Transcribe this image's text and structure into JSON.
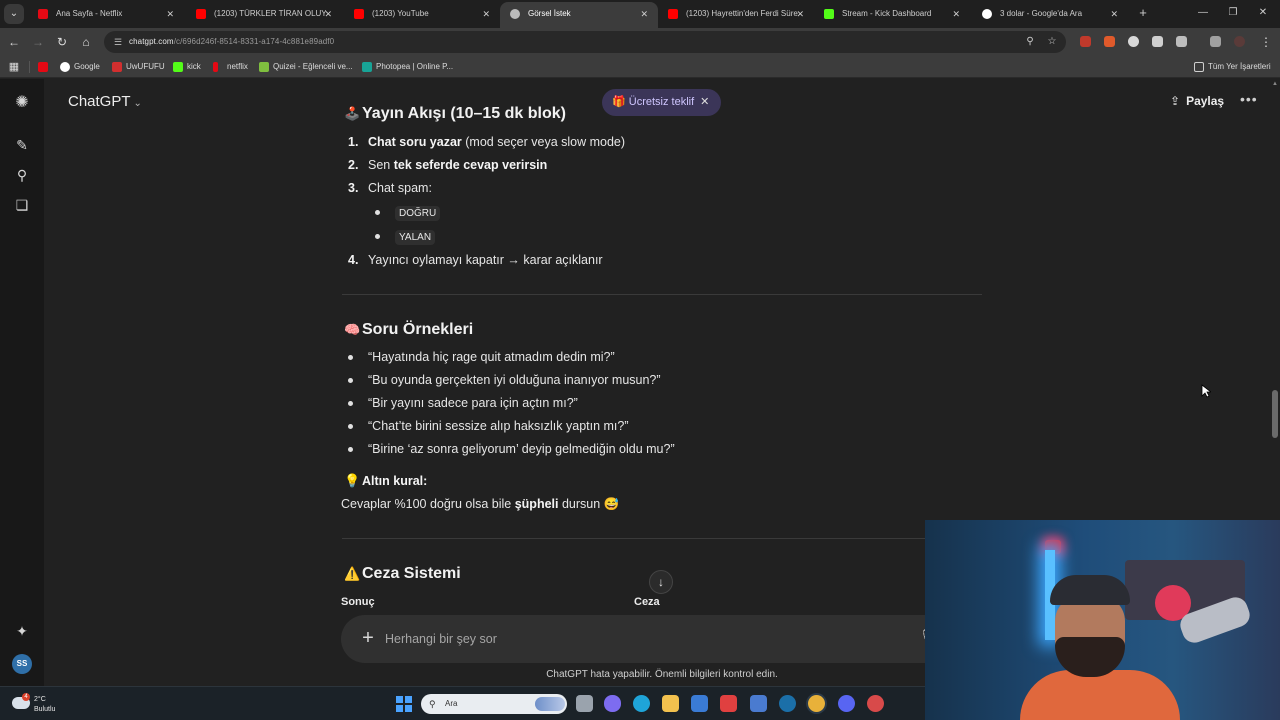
{
  "browser": {
    "tabs": [
      {
        "title": "Ana Sayfa - Netflix",
        "favicon_color": "#e50914",
        "active": false
      },
      {
        "title": "(1203) TÜRKLER TİRAN OLUYOR",
        "favicon_color": "#ff0000",
        "active": false
      },
      {
        "title": "(1203) YouTube",
        "favicon_color": "#ff0000",
        "active": false
      },
      {
        "title": "Görsel İstek",
        "favicon_color": "#bbbbbb",
        "active": true
      },
      {
        "title": "(1203) Hayrettin'den Ferdi Süre",
        "favicon_color": "#ff0000",
        "active": false
      },
      {
        "title": "Stream - Kick Dashboard",
        "favicon_color": "#53fc18",
        "active": false
      },
      {
        "title": "3 dolar - Google'da Ara",
        "favicon_color": "#ffffff",
        "active": false
      }
    ],
    "new_tab": "+",
    "url_host": "chatgpt.com",
    "url_path": "/c/696d246f-8514-8331-a174-4c881e89adf0",
    "bookmarks": [
      {
        "label": "",
        "color": "#e50914"
      },
      {
        "label": "Google",
        "color": "#ffffff"
      },
      {
        "label": "UwUFUFU",
        "color": "#d22f2f"
      },
      {
        "label": "kick",
        "color": "#53fc18"
      },
      {
        "label": "netflix",
        "color": "#e50914"
      },
      {
        "label": "Quizei - Eğlenceli ve...",
        "color": "#7fbf3f"
      },
      {
        "label": "Photopea | Online P...",
        "color": "#18a497"
      }
    ],
    "all_bookmarks": "Tüm Yer İşaretleri"
  },
  "app": {
    "model": "ChatGPT",
    "offer": "Ücretsiz teklif",
    "share": "Paylaş"
  },
  "content": {
    "section1": {
      "emoji": "🕹️",
      "title": "Yayın Akışı (10–15 dk blok)",
      "steps": [
        {
          "n": "1.",
          "bold": "Chat soru yazar",
          "rest": " (mod seçer veya slow mode)"
        },
        {
          "n": "2.",
          "pre": "Sen ",
          "bold": "tek seferde cevap verirsin"
        },
        {
          "n": "3.",
          "pre": "Chat spam:"
        },
        {
          "n": "4.",
          "pre": "Yayıncı oylamayı kapatır → karar açıklanır"
        }
      ],
      "votes": [
        "DOĞRU",
        "YALAN"
      ]
    },
    "section2": {
      "emoji": "🧠",
      "title": "Soru Örnekleri",
      "questions": [
        "“Hayatında hiç rage quit atmadım dedin mi?”",
        "“Bu oyunda gerçekten iyi olduğuna inanıyor musun?”",
        "“Bir yayını sadece para için açtın mı?”",
        "“Chat’te birini sessize alıp haksızlık yaptın mı?”",
        "“Birine ‘az sonra geliyorum’ deyip gelmediğin oldu mu?”"
      ],
      "golden_emoji": "💡",
      "golden_title": "Altın kural:",
      "golden_pre": "Cevaplar %100 doğru olsa bile ",
      "golden_bold": "şüpheli",
      "golden_post": " dursun 😅"
    },
    "section3": {
      "emoji": "⚠️",
      "title": "Ceza Sistemi",
      "col1": "Sonuç",
      "col2": "Ceza"
    }
  },
  "composer": {
    "placeholder": "Herhangi bir şey sor",
    "disclaimer": "ChatGPT hata yapabilir. Önemli bilgileri kontrol edin."
  },
  "taskbar": {
    "temp": "2°C",
    "condition": "Bulutlu",
    "weather_badge": "4",
    "search_label": "Ara",
    "apps": [
      {
        "name": "task-view",
        "color": "#9aa3ad"
      },
      {
        "name": "copilot",
        "color": "#7d6cf0"
      },
      {
        "name": "edge",
        "color": "#1fa4d8"
      },
      {
        "name": "file-explorer",
        "color": "#f2c14e"
      },
      {
        "name": "store",
        "color": "#3a7bd5"
      },
      {
        "name": "app-red",
        "color": "#e04040"
      },
      {
        "name": "app-blue",
        "color": "#4a7bd0"
      },
      {
        "name": "steam",
        "color": "#1b6fa8"
      },
      {
        "name": "chrome",
        "color": "#e8b13a"
      },
      {
        "name": "discord",
        "color": "#5865f2"
      },
      {
        "name": "app-game",
        "color": "#d84a4a"
      }
    ]
  }
}
